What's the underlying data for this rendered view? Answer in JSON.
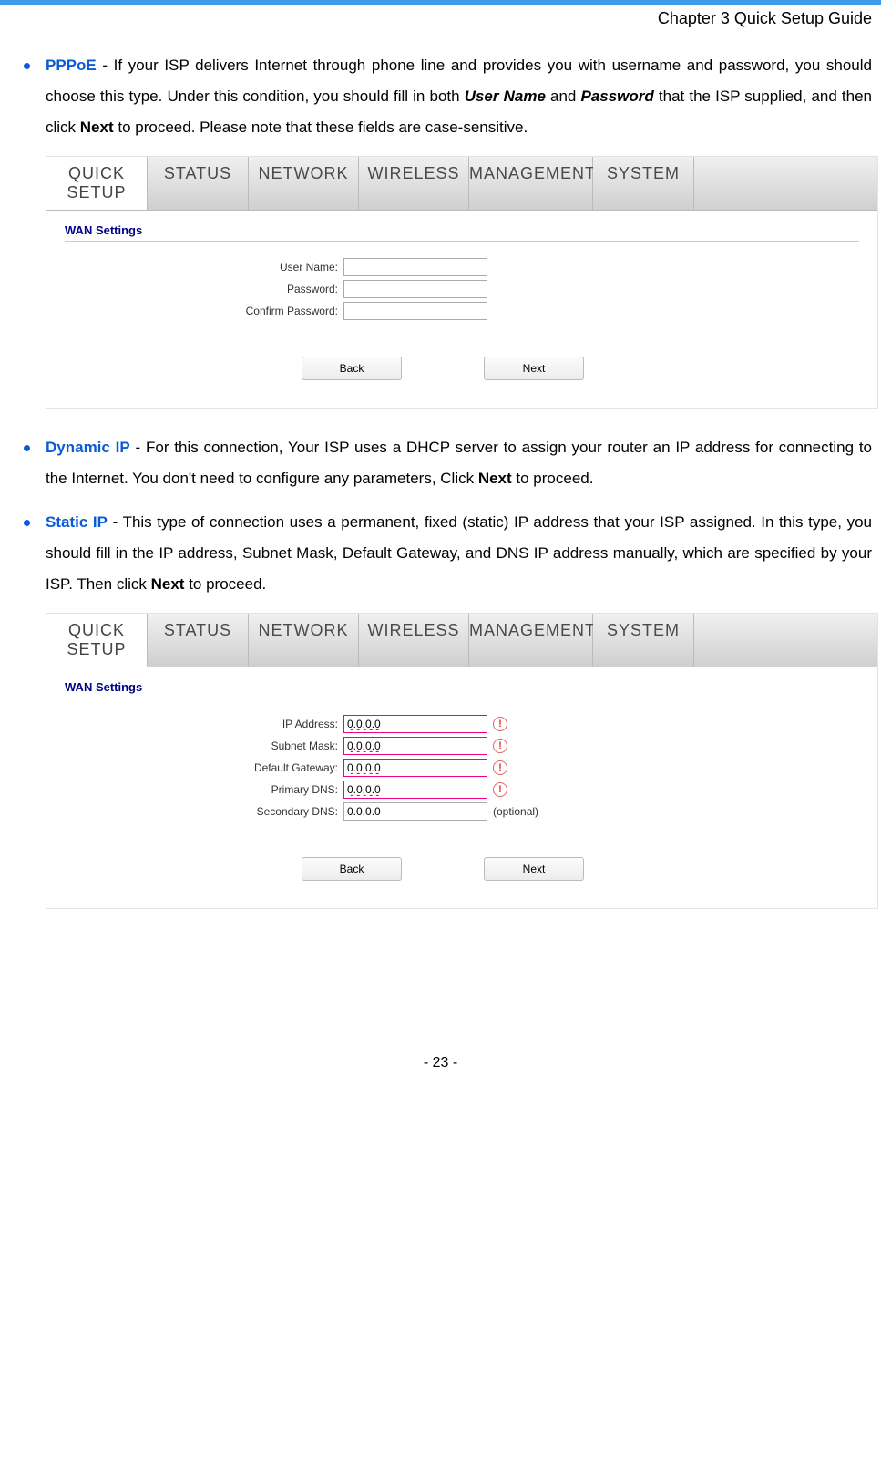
{
  "chapter": "Chapter 3 Quick Setup Guide",
  "bullets": {
    "pppoe": {
      "title": "PPPoE",
      "t1": " - If your ISP delivers Internet through phone line and provides you with username and password, you should choose this type. Under this condition, you should fill in both ",
      "em1": "User Name",
      "t2": " and ",
      "em2": "Password",
      "t3": " that the ISP supplied, and then click ",
      "b1": "Next",
      "t4": " to proceed. Please note that these fields are case-sensitive."
    },
    "dynamic": {
      "title": "Dynamic IP",
      "t1": " - For this connection, Your ISP uses a DHCP server to assign your router an IP address for connecting to the Internet. You don't need to configure any parameters, Click ",
      "b1": "Next",
      "t2": " to proceed."
    },
    "static": {
      "title": "Static IP",
      "t1": " - This type of connection uses a permanent, fixed (static) IP address that your ISP assigned. In this type, you should fill in the IP address, Subnet Mask, Default Gateway, and DNS IP address manually, which are specified by your ISP. Then click ",
      "b1": "Next",
      "t2": " to proceed."
    }
  },
  "nav": [
    "QUICK SETUP",
    "STATUS",
    "NETWORK",
    "WIRELESS",
    "MANAGEMENT",
    "SYSTEM"
  ],
  "panel_heading": "WAN Settings",
  "pppoe_form": {
    "f1": "User Name:",
    "f2": "Password:",
    "f3": "Confirm Password:"
  },
  "static_form": {
    "f1": "IP Address:",
    "f2": "Subnet Mask:",
    "f3": "Default Gateway:",
    "f4": "Primary DNS:",
    "f5": "Secondary DNS:",
    "val": "0.0.0.0",
    "optional": "(optional)"
  },
  "buttons": {
    "back": "Back",
    "next": "Next"
  },
  "error_glyph": "!",
  "page_number": "- 23 -"
}
